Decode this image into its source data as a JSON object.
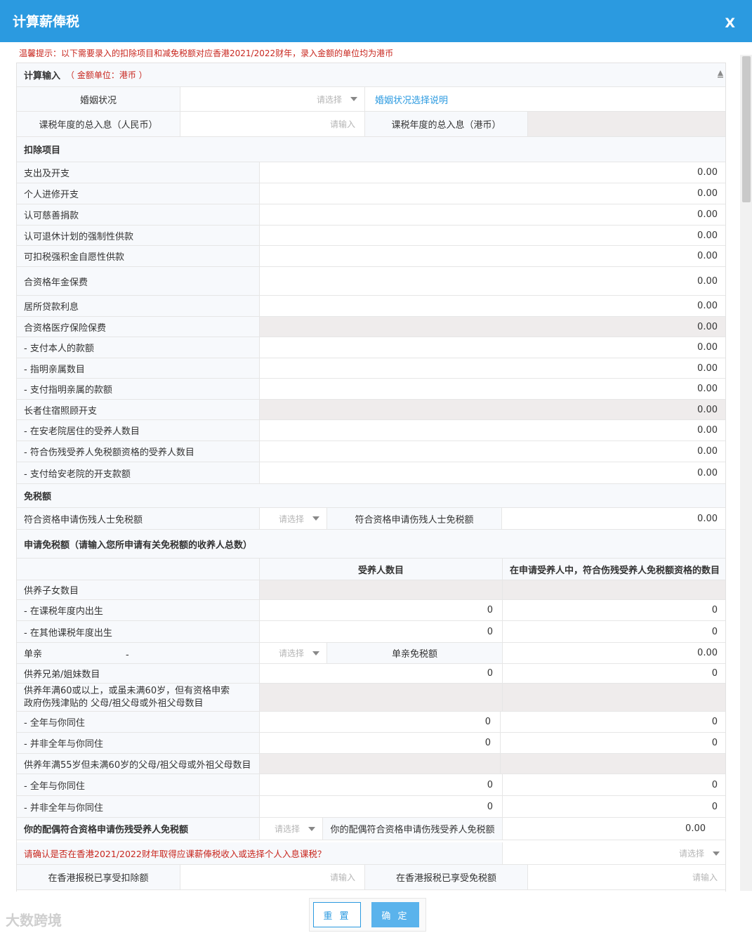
{
  "window": {
    "title": "计算薪俸税",
    "close": "X"
  },
  "notice": "温馨提示：以下需要录入的扣除项目和减免税额对应香港2021/2022财年，录入金额的单位均为港币",
  "section_input": {
    "title": "计算输入",
    "unit": "（ 金额单位：港币 ）"
  },
  "marital": {
    "label": "婚姻状况",
    "select": "请选择",
    "link": "婚姻状况选择说明"
  },
  "income": {
    "label_rmb": "课税年度的总入息（人民币）",
    "placeholder": "请输入",
    "label_hkd": "课税年度的总入息（港币）"
  },
  "deductions": {
    "title": "扣除项目",
    "items": [
      {
        "label": "支出及开支",
        "value": "0.00"
      },
      {
        "label": "个人进修开支",
        "value": "0.00"
      },
      {
        "label": "认可慈善捐款",
        "value": "0.00"
      },
      {
        "label": "认可退休计划的强制性供款",
        "value": "0.00"
      },
      {
        "label": "可扣税强积金自愿性供款",
        "value": "0.00"
      },
      {
        "label": "合资格年金保费",
        "value": "0.00"
      },
      {
        "label": "居所贷款利息",
        "value": "0.00"
      },
      {
        "label": "合资格医疗保险保费",
        "value": "0.00"
      },
      {
        "label": "- 支付本人的款额",
        "value": "0.00"
      },
      {
        "label": "- 指明亲属数目",
        "value": "0.00"
      },
      {
        "label": "- 支付指明亲属的款额",
        "value": "0.00"
      },
      {
        "label": "长者住宿照顾开支",
        "value": "0.00"
      },
      {
        "label": "- 在安老院居住的受养人数目",
        "value": "0.00"
      },
      {
        "label": "- 符合伤残受养人免税额资格的受养人数目",
        "value": "0.00"
      },
      {
        "label": "- 支付给安老院的开支款额",
        "value": "0.00"
      }
    ]
  },
  "exemption": {
    "title": "免税额",
    "disabled_label": "符合资格申请伤残人士免税额",
    "disabled_select": "请选择",
    "disabled_label2": "符合资格申请伤残人士免税额",
    "disabled_value": "0.00"
  },
  "claims": {
    "title": "申请免税额（请输入您所申请有关免税额的收养人总数）",
    "col1": "受养人数目",
    "col2": "在申请受养人中，符合伤残受养人免税额资格的数目",
    "children": "供养子女数目",
    "born_in_year": {
      "label": "- 在课税年度内出生",
      "v1": "0",
      "v2": "0"
    },
    "born_other": {
      "label": "- 在其他课税年度出生",
      "v1": "0",
      "v2": "0"
    },
    "single": {
      "label": "单亲",
      "dash": "-",
      "select": "请选择",
      "label2": "单亲免税额",
      "value": "0.00"
    },
    "siblings": {
      "label": "供养兄弟/姐妹数目",
      "v1": "0",
      "v2": "0"
    },
    "parents60": "供养年满60或以上，或虽未满60岁，但有资格申索政府伤残津贴的 父母/祖父母或外祖父母数目",
    "p60_full": {
      "label": "- 全年与你同住",
      "v1": "0",
      "v2": "0"
    },
    "p60_part": {
      "label": "- 并非全年与你同住",
      "v1": "0",
      "v2": "0"
    },
    "parents55": "供养年满55岁但未满60岁的父母/祖父母或外祖父母数目",
    "p55_full": {
      "label": "- 全年与你同住",
      "v1": "0",
      "v2": "0"
    },
    "p55_part": {
      "label": "- 并非全年与你同住",
      "v1": "0",
      "v2": "0"
    },
    "spouse": {
      "label": "你的配偶符合资格申请伤残受养人免税额",
      "select": "请选择",
      "label2": "你的配偶符合资格申请伤残受养人免税额",
      "value": "0.00"
    }
  },
  "confirm": {
    "question": "请确认是否在香港2021/2022财年取得应课薪俸税收入或选择个人入息课税？",
    "select": "请选择"
  },
  "hk_tax": {
    "deduction_label": "在香港报税已享受扣除额",
    "placeholder": "请输入",
    "exempt_label": "在香港报税已享受免税额",
    "placeholder2": "请输入"
  },
  "buttons": {
    "reset": "重 置",
    "ok": "确 定"
  },
  "watermark": "大数跨境"
}
